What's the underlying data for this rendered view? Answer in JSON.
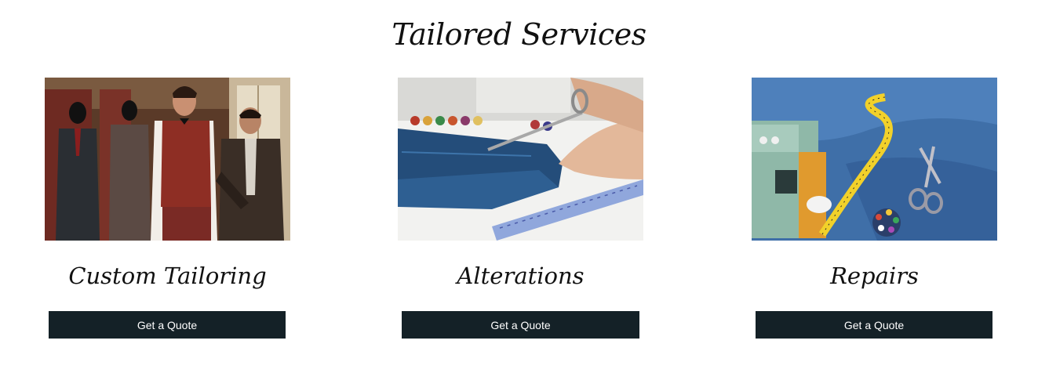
{
  "section": {
    "title": "Tailored Services"
  },
  "services": [
    {
      "title": "Custom Tailoring",
      "button_label": "Get a Quote",
      "image_subject": "tailor fitting a man's suit beside mannequins"
    },
    {
      "title": "Alterations",
      "button_label": "Get a Quote",
      "image_subject": "scissors cutting denim jeans next to a ruler"
    },
    {
      "title": "Repairs",
      "button_label": "Get a Quote",
      "image_subject": "sewing machine with tape measure and scissors on denim"
    }
  ],
  "colors": {
    "button_bg": "#142127",
    "button_text": "#ffffff",
    "heading_text": "#111111"
  }
}
